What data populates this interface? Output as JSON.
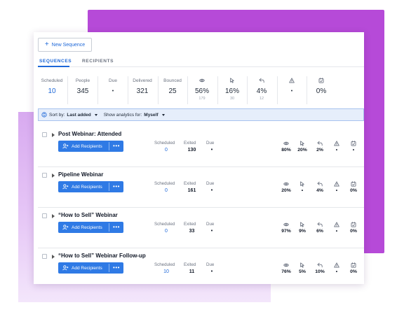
{
  "toolbar": {
    "new_sequence_label": "New Sequence"
  },
  "tabs": [
    {
      "label": "SEQUENCES"
    },
    {
      "label": "RECIPIENTS"
    }
  ],
  "stats": {
    "scheduled": {
      "label": "Scheduled",
      "value": "10"
    },
    "people": {
      "label": "People",
      "value": "345"
    },
    "due": {
      "label": "Due",
      "value": "•"
    },
    "delivered": {
      "label": "Delivered",
      "value": "321"
    },
    "bounced": {
      "label": "Bounced",
      "value": "25"
    },
    "opened": {
      "icon": "eye-icon",
      "value": "56%",
      "sub": "179"
    },
    "clicked": {
      "icon": "cursor-icon",
      "value": "16%",
      "sub": "30"
    },
    "replied": {
      "icon": "reply-icon",
      "value": "4%",
      "sub": "12"
    },
    "warning": {
      "icon": "warning-icon",
      "value": "•"
    },
    "finished": {
      "icon": "calendar-check-icon",
      "value": "0%"
    }
  },
  "sortbar": {
    "sort_by_label": "Sort by:",
    "sort_by_value": "Last added",
    "analytics_label": "Show analytics for:",
    "analytics_value": "Myself"
  },
  "row_labels": {
    "add_recipients": "Add Recipients",
    "more": "•••",
    "scheduled": "Scheduled",
    "exited": "Exited",
    "due": "Due"
  },
  "sequences": [
    {
      "name": "Post Webinar: Attended",
      "scheduled": "0",
      "exited": "130",
      "due": "•",
      "opened": "80%",
      "clicked": "20%",
      "replied": "2%",
      "warning": "•",
      "finished": "•"
    },
    {
      "name": "Pipeline Webinar",
      "scheduled": "0",
      "exited": "161",
      "due": "•",
      "opened": "20%",
      "clicked": "•",
      "replied": "4%",
      "warning": "•",
      "finished": "0%"
    },
    {
      "name": "“How to Sell” Webinar",
      "scheduled": "0",
      "exited": "33",
      "due": "•",
      "opened": "97%",
      "clicked": "9%",
      "replied": "6%",
      "warning": "•",
      "finished": "0%"
    },
    {
      "name": "“How to Sell” Webinar Follow-up",
      "scheduled": "10",
      "exited": "11",
      "due": "•",
      "opened": "76%",
      "clicked": "5%",
      "replied": "10%",
      "warning": "•",
      "finished": "0%"
    }
  ],
  "colors": {
    "accent": "#1d67d8",
    "button": "#2f7ae5",
    "purple": "#b64ad8",
    "sortbar_bg": "#e6eefb"
  }
}
